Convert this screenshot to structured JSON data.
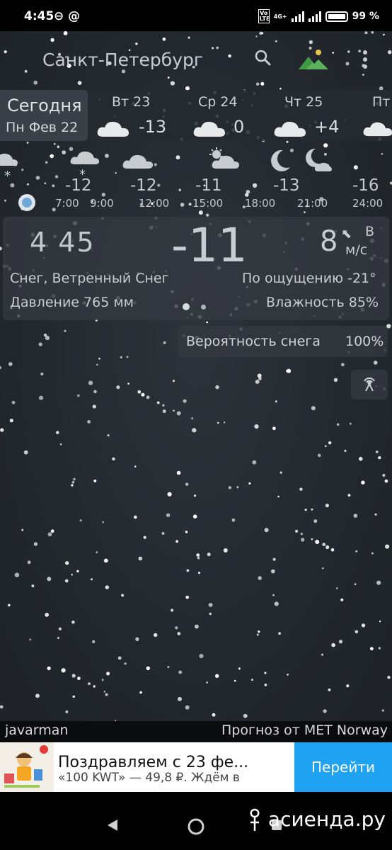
{
  "status": {
    "time": "4:45",
    "left_icons": "⊖ @",
    "network": "4G+",
    "volte": "Vo LTE",
    "battery": "99 %"
  },
  "header": {
    "city": "Санкт-Петербург",
    "icons": [
      "search-icon",
      "landscape-icon",
      "more-vert-icon"
    ]
  },
  "days": {
    "today": {
      "label": "Сегодня",
      "date": "Пн Фев 22"
    },
    "items": [
      {
        "name": "Вт 23",
        "temp": "-13",
        "icon": "cloud-icon"
      },
      {
        "name": "Ср 24",
        "temp": "0",
        "icon": "cloud-icon"
      },
      {
        "name": "Чт 25",
        "temp": "+4",
        "icon": "cloud-icon"
      },
      {
        "name": "Пт",
        "temp": "",
        "icon": "cloud-icon"
      }
    ]
  },
  "hourly": [
    {
      "time": "7:00",
      "temp": "-12",
      "icon": "snow-cloud-icon"
    },
    {
      "time": "9:00",
      "temp": "",
      "icon": ""
    },
    {
      "time": "12:00",
      "temp": "-12",
      "icon": "cloud-icon"
    },
    {
      "time": "15:00",
      "temp": "-11",
      "icon": "partly-cloudy-icon"
    },
    {
      "time": "18:00",
      "temp": "-13",
      "icon": "moon-icon"
    },
    {
      "time": "21:00",
      "temp": "",
      "icon": "moon-cloud-icon"
    },
    {
      "time": "24:00",
      "temp": "-16",
      "icon": ""
    }
  ],
  "current": {
    "time": "4 45",
    "temp": "-11",
    "wind_speed": "8",
    "wind_dir": "В",
    "wind_unit": "м/с",
    "condition": "Снег, Ветренный Снег",
    "feels_like": "По ощущению -21°",
    "pressure": "Давление 765 мм",
    "humidity": "Влажность 85%"
  },
  "precip": {
    "label": "Вероятность снега",
    "value": "100%"
  },
  "credits": {
    "left": "javarman",
    "right": "Прогноз от MET Norway"
  },
  "ad": {
    "title": "Поздравляем с 23 фе...",
    "subtitle": "«100 KWT» — 49,8 ₽. Ждём в",
    "button": "Перейти"
  },
  "watermark": "асиенда.ру",
  "colors": {
    "background": "#22262d",
    "ad_button": "#1ea2f1",
    "panel": "#343840"
  }
}
